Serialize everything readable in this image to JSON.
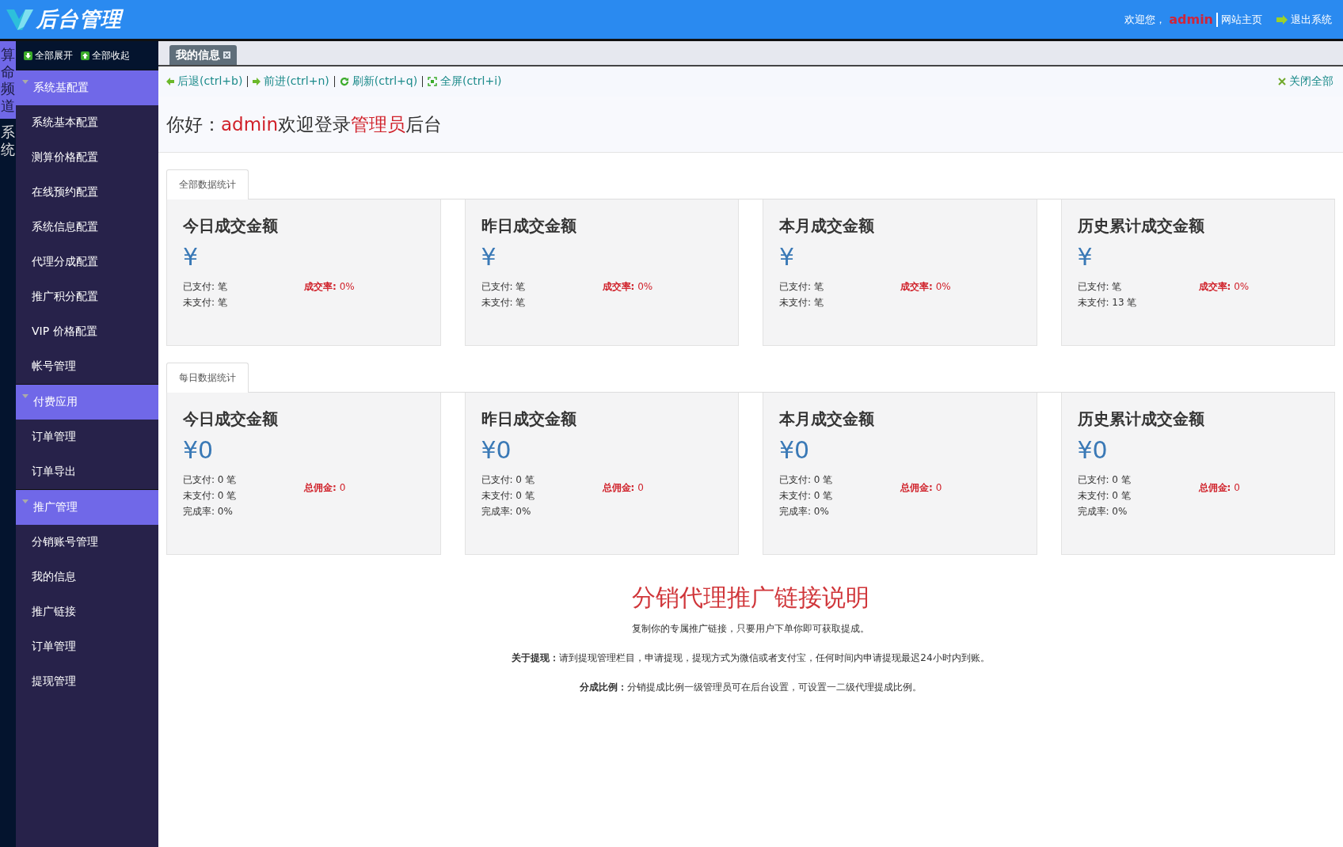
{
  "header": {
    "title": "后台管理",
    "welcome": "欢迎您，",
    "user": "admin",
    "home_link": "网站主页",
    "logout": "退出系统"
  },
  "channels": [
    {
      "label": "算命频道",
      "selected": true
    },
    {
      "label": "系统",
      "selected": false
    }
  ],
  "sidebar": {
    "expand_all": "全部展开",
    "collapse_all": "全部收起",
    "groups": [
      {
        "label": "系统基配置",
        "expanded": true,
        "children": [
          {
            "label": "系统基本配置"
          },
          {
            "label": "测算价格配置"
          },
          {
            "label": "在线预约配置"
          },
          {
            "label": "系统信息配置"
          },
          {
            "label": "代理分成配置"
          },
          {
            "label": "推广积分配置"
          },
          {
            "label": "VIP 价格配置"
          },
          {
            "label": "帐号管理"
          }
        ]
      },
      {
        "label": "付费应用",
        "expanded": true,
        "children": [
          {
            "label": "订单管理"
          },
          {
            "label": "订单导出"
          }
        ]
      },
      {
        "label": "推广管理",
        "expanded": true,
        "children": [
          {
            "label": "分销账号管理"
          },
          {
            "label": "我的信息"
          },
          {
            "label": "推广链接"
          },
          {
            "label": "订单管理"
          },
          {
            "label": "提现管理"
          }
        ]
      }
    ]
  },
  "tabs": [
    {
      "label": "我的信息",
      "selected": true
    }
  ],
  "toolbar": {
    "actions": [
      {
        "kind": "back",
        "label": "后退(ctrl+b)"
      },
      {
        "kind": "forward",
        "label": "前进(ctrl+n)"
      },
      {
        "kind": "refresh",
        "label": "刷新(ctrl+q)"
      },
      {
        "kind": "fullscreen",
        "label": "全屏(ctrl+i)"
      }
    ],
    "close_all": "关闭全部"
  },
  "greeting": {
    "prefix": "你好：",
    "user": "admin",
    "middle": "欢迎登录",
    "role": "管理员",
    "suffix": "后台"
  },
  "sections": [
    {
      "tab": "全部数据统计",
      "cards": [
        {
          "title": "今日成交金额",
          "amount": "¥",
          "lines": [
            "已支付: 笔",
            "未支付: 笔"
          ],
          "highlight": {
            "label": "成交率:",
            "value": "0%"
          }
        },
        {
          "title": "昨日成交金额",
          "amount": "¥",
          "lines": [
            "已支付: 笔",
            "未支付: 笔"
          ],
          "highlight": {
            "label": "成交率:",
            "value": "0%"
          }
        },
        {
          "title": "本月成交金额",
          "amount": "¥",
          "lines": [
            "已支付: 笔",
            "未支付: 笔"
          ],
          "highlight": {
            "label": "成交率:",
            "value": "0%"
          }
        },
        {
          "title": "历史累计成交金额",
          "amount": "¥",
          "lines": [
            "已支付: 笔",
            "未支付: 13 笔"
          ],
          "highlight": {
            "label": "成交率:",
            "value": "0%"
          }
        }
      ]
    },
    {
      "tab": "每日数据统计",
      "cards": [
        {
          "title": "今日成交金额",
          "amount": "¥0",
          "lines": [
            "已支付: 0 笔",
            "未支付: 0 笔",
            "完成率: 0%"
          ],
          "highlight": {
            "label": "总佣金:",
            "value": "0"
          }
        },
        {
          "title": "昨日成交金额",
          "amount": "¥0",
          "lines": [
            "已支付: 0 笔",
            "未支付: 0 笔",
            "完成率: 0%"
          ],
          "highlight": {
            "label": "总佣金:",
            "value": "0"
          }
        },
        {
          "title": "本月成交金额",
          "amount": "¥0",
          "lines": [
            "已支付: 0 笔",
            "未支付: 0 笔",
            "完成率: 0%"
          ],
          "highlight": {
            "label": "总佣金:",
            "value": "0"
          }
        },
        {
          "title": "历史累计成交金额",
          "amount": "¥0",
          "lines": [
            "已支付: 0 笔",
            "未支付: 0 笔",
            "完成率: 0%"
          ],
          "highlight": {
            "label": "总佣金:",
            "value": "0"
          }
        }
      ]
    }
  ],
  "notice": {
    "title": "分销代理推广链接说明",
    "paragraphs": [
      "复制你的专属推广链接，只要用户下单你即可获取提成。",
      "**关于提现：**请到提现管理栏目，申请提现，提现方式为微信或者支付宝，任何时间内申请提现最迟24小时内到账。",
      "**分成比例：**分销提成比例一级管理员可在后台设置，可设置一二级代理提成比例。"
    ]
  }
}
